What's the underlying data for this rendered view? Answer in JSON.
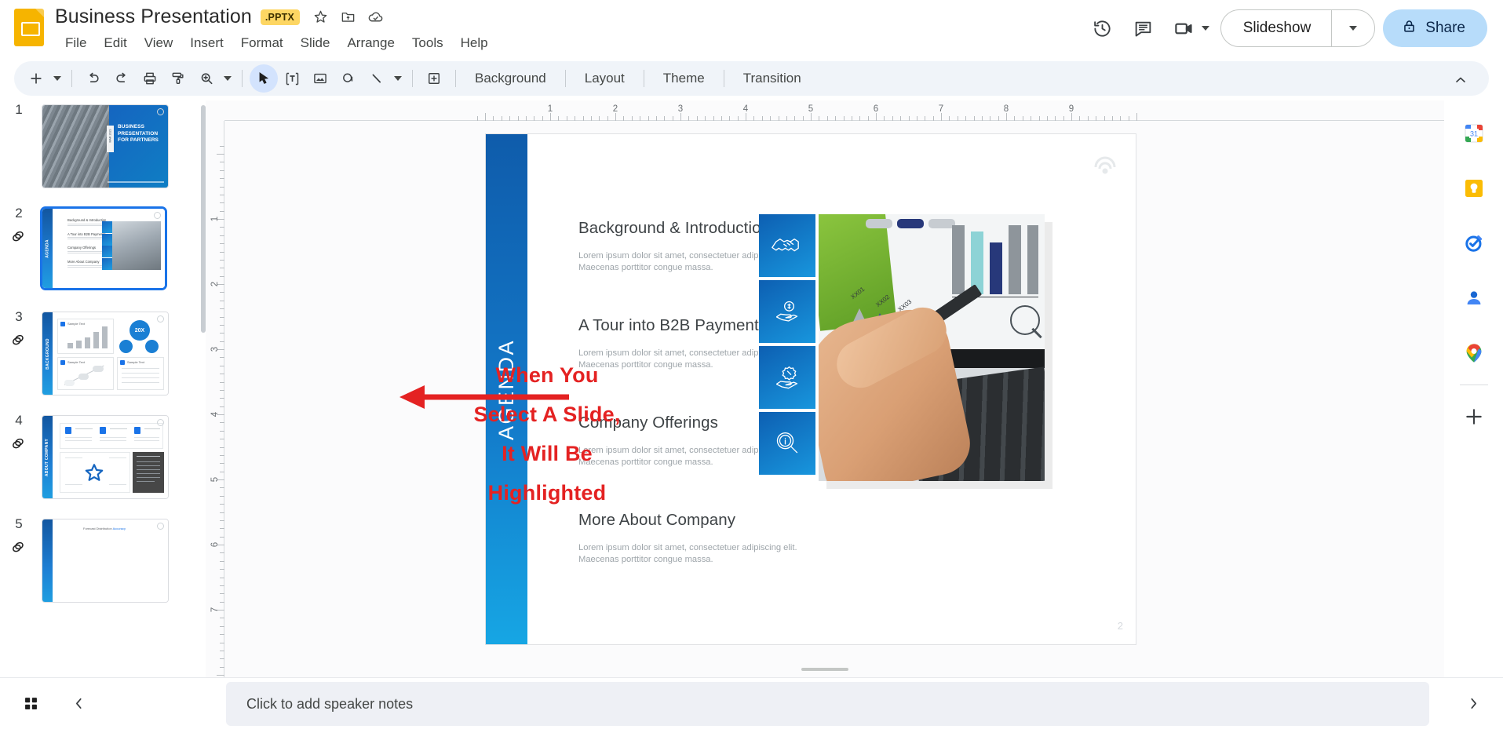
{
  "app": {
    "product": "Google Slides",
    "doc_title": "Business Presentation",
    "file_badge": ".PPTX",
    "accent_blue": "#1a73e8",
    "annotation_red": "#E42222",
    "share_bg": "#B7DCFA"
  },
  "titlebar": {
    "icons": [
      {
        "name": "star-icon",
        "label": "Star"
      },
      {
        "name": "move-to-folder-icon",
        "label": "Move"
      },
      {
        "name": "cloud-saved-icon",
        "label": "Saved to Drive"
      }
    ]
  },
  "menubar": {
    "items": [
      {
        "label": "File"
      },
      {
        "label": "Edit"
      },
      {
        "label": "View"
      },
      {
        "label": "Insert"
      },
      {
        "label": "Format"
      },
      {
        "label": "Slide"
      },
      {
        "label": "Arrange"
      },
      {
        "label": "Tools"
      },
      {
        "label": "Help"
      }
    ]
  },
  "header_actions": {
    "history_icon": "version-history-icon",
    "comment_icon": "comment-icon",
    "meet_icon": "meet-camera-icon",
    "slideshow_label": "Slideshow",
    "slideshow_caret": "chevron-down-icon",
    "share_label": "Share",
    "share_lock_icon": "lock-icon"
  },
  "toolbar": {
    "buttons": [
      {
        "name": "new-slide-button",
        "icon": "plus-icon"
      },
      {
        "name": "new-slide-dropdown",
        "icon": "chevron-down-icon"
      },
      {
        "name": "undo-button",
        "icon": "undo-icon"
      },
      {
        "name": "redo-button",
        "icon": "redo-icon"
      },
      {
        "name": "print-button",
        "icon": "printer-icon"
      },
      {
        "name": "paint-format-button",
        "icon": "paint-roller-icon"
      },
      {
        "name": "zoom-button",
        "icon": "zoom-icon"
      },
      {
        "name": "zoom-dropdown",
        "icon": "chevron-down-icon"
      },
      {
        "name": "select-tool-button",
        "icon": "cursor-arrow-icon"
      },
      {
        "name": "text-box-button",
        "icon": "text-box-icon"
      },
      {
        "name": "insert-image-button",
        "icon": "image-icon"
      },
      {
        "name": "shape-button",
        "icon": "shape-icon"
      },
      {
        "name": "line-button",
        "icon": "line-icon"
      },
      {
        "name": "line-dropdown",
        "icon": "chevron-down-icon"
      },
      {
        "name": "add-comment-button",
        "icon": "add-comment-icon"
      }
    ],
    "text_buttons": [
      {
        "label": "Background"
      },
      {
        "label": "Layout"
      },
      {
        "label": "Theme"
      },
      {
        "label": "Transition"
      }
    ],
    "collapse_icon": "chevron-up-icon"
  },
  "filmstrip": {
    "slides": [
      {
        "number": "1",
        "selected": false,
        "has_layers_icon": false,
        "title": "BUSINESS PRESENTATION FOR PARTNERS",
        "date_tag": "MAR 2023"
      },
      {
        "number": "2",
        "selected": true,
        "has_layers_icon": true,
        "title": "AGENDA"
      },
      {
        "number": "3",
        "selected": false,
        "has_layers_icon": true,
        "title": "BACKGROUND",
        "stat": "20X",
        "card_labels": [
          "Sample Text",
          "Sample Text",
          "Sample Text"
        ]
      },
      {
        "number": "4",
        "selected": false,
        "has_layers_icon": true,
        "title": "ABOUT COMPANY"
      },
      {
        "number": "5",
        "selected": false,
        "has_layers_icon": true,
        "title": ""
      }
    ]
  },
  "ruler": {
    "horizontal_ticks": [
      "1",
      "2",
      "3",
      "4",
      "5",
      "6",
      "7",
      "8",
      "9"
    ],
    "vertical_ticks": [
      "1",
      "2",
      "3",
      "4",
      "5",
      "6",
      "7"
    ],
    "unit": "inch"
  },
  "slide": {
    "sidebar_label": "AGENDA",
    "page_number": "2",
    "logo_icon": "company-logo-icon",
    "agenda": [
      {
        "title": "Background & Introduction",
        "desc": "Lorem ipsum dolor sit amet, consectetuer adipiscing elit. Maecenas porttitor congue massa."
      },
      {
        "title": "A Tour into B2B Payments",
        "desc": "Lorem ipsum dolor sit amet, consectetuer adipiscing elit. Maecenas porttitor congue massa."
      },
      {
        "title": "Company Offerings",
        "desc": "Lorem ipsum dolor sit amet, consectetuer adipiscing elit. Maecenas porttitor congue massa."
      },
      {
        "title": "More About Company",
        "desc": "Lorem ipsum dolor sit amet, consectetuer adipiscing elit. Maecenas porttitor congue massa."
      }
    ],
    "tiles": [
      {
        "icon": "handshake-icon"
      },
      {
        "icon": "hand-money-icon"
      },
      {
        "icon": "hand-discount-icon"
      },
      {
        "icon": "magnifier-info-icon"
      }
    ],
    "photo_alt": "hand-holding-pen-over-laptop-with-charts"
  },
  "annotation": {
    "lines": [
      "When You",
      "Select A Slide,",
      "It Will Be",
      "Highlighted"
    ],
    "arrow_icon": "left-arrow-annotation"
  },
  "right_rail": {
    "items": [
      {
        "name": "google-calendar-icon",
        "label": "Calendar",
        "badge": "31"
      },
      {
        "name": "google-keep-icon",
        "label": "Keep"
      },
      {
        "name": "google-tasks-icon",
        "label": "Tasks"
      },
      {
        "name": "google-contacts-icon",
        "label": "Contacts"
      },
      {
        "name": "google-maps-icon",
        "label": "Maps"
      },
      {
        "name": "add-on-plus-icon",
        "label": "Get Add-ons"
      }
    ]
  },
  "bottombar": {
    "grid_view_icon": "grid-view-icon",
    "collapse_filmstrip_icon": "chevron-left-icon",
    "notes_placeholder": "Click to add speaker notes",
    "expand_icon": "chevron-right-icon"
  }
}
